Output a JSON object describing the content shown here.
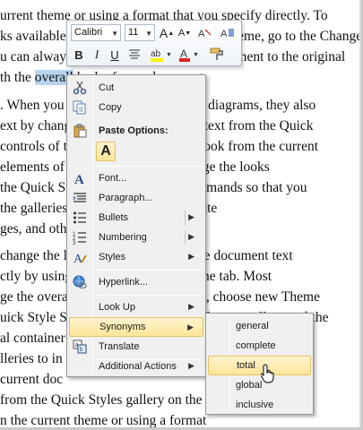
{
  "document": {
    "lines": [
      "urrent theme or using a format that you specify directly. To",
      "ks available in the context of the current theme, go to the Change Current",
      "u can always restore the look of your document to the original",
      "th the ",
      "overall",
      " look of your document.",
      ". When you insert pictures, charts, or diagrams, they also",
      "ext by changing the look of selected text from the Quick",
      "controls of the Home tab. Choose a look from the current",
      "elements of your document. To change the looks",
      "the Quick Styles gallery, use the commands so that you",
      "the galleries are designed to coordinate",
      "ges, and other document blocks.",
      "change the look of selected text in the document text",
      "ctly by using the controls on the Home tab. Most",
      "ge the overall look of your document, choose new Theme",
      "uick Style Set commands. Both the Themes gallery and the",
      "al container of your document, the",
      "lleries to in ries,",
      "current doc",
      "from the Quick Styles gallery on the also",
      "n the current theme or using a format"
    ]
  },
  "minitoolbar": {
    "font_name": "Calibri",
    "font_size": "11",
    "buttons": {
      "grow": "A",
      "shrink": "A",
      "format_painter_a": "A",
      "bold": "B",
      "italic": "I",
      "underline": "U",
      "center": "≡",
      "highlight": "ab",
      "font_color": "A"
    }
  },
  "context_menu": {
    "cut": "Cut",
    "copy": "Copy",
    "paste_options": "Paste Options:",
    "paste_keep": "A",
    "font": "Font...",
    "paragraph": "Paragraph...",
    "bullets": "Bullets",
    "numbering": "Numbering",
    "styles": "Styles",
    "hyperlink": "Hyperlink...",
    "lookup": "Look Up",
    "synonyms": "Synonyms",
    "translate": "Translate",
    "additional_actions": "Additional Actions"
  },
  "synonyms": [
    "general",
    "complete",
    "total",
    "global",
    "inclusive"
  ],
  "colors": {
    "highlight": "#fde598",
    "selection": "#b9d4ef",
    "font_color_bar": "#e02020",
    "highlight_bar": "#f5f500"
  }
}
